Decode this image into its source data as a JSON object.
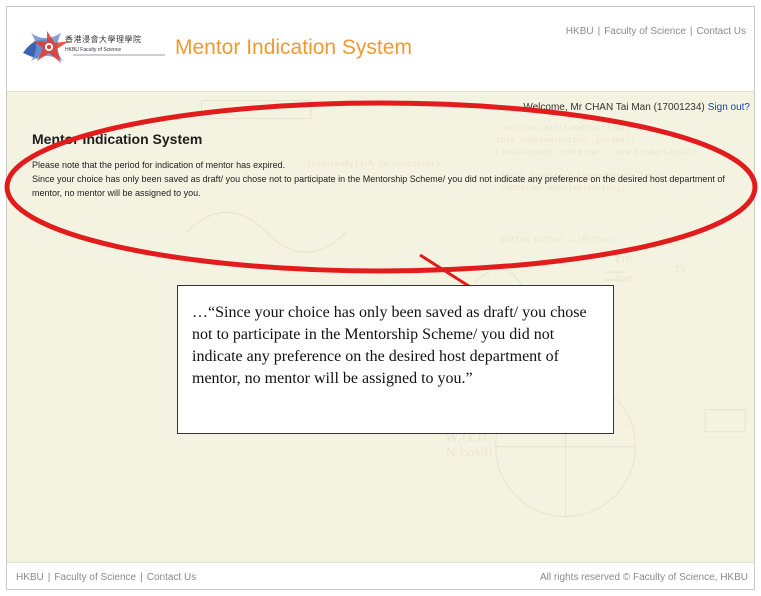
{
  "header": {
    "logo_cn": "香港浸會大學理學院",
    "logo_en": "HKBU Faculty of Science",
    "system_title": "Mentor Indication System",
    "top_links": [
      "HKBU",
      "Faculty of Science",
      "Contact Us"
    ]
  },
  "main": {
    "welcome_text": "Welcome, Mr CHAN Tai Man (17001234)",
    "sign_out_label": "Sign out?",
    "heading": "Mentor Indication System",
    "notice_line1": "Please note that the period for indication of mentor has expired.",
    "notice_line2": "Since your choice has only been saved as draft/ you chose not to participate in the Mentorship Scheme/ you did not indicate any preference on the desired host department of mentor, no mentor will be assigned to you."
  },
  "callout": {
    "text": "…“Since your choice has only been saved as draft/ you chose not to participate in the Mentorship Scheme/ you did not indicate any preference on the desired host department of mentor, no mentor will be assigned to you.”"
  },
  "footer": {
    "links": [
      "HKBU",
      "Faculty of Science",
      "Contact Us"
    ],
    "copyright": "All rights reserved © Faculty of Science, HKBU"
  },
  "colors": {
    "accent_orange": "#ef9a2e",
    "highlight_red": "#e21c1c",
    "link_blue": "#1a3fb4",
    "content_bg": "#f4f3e1"
  }
}
